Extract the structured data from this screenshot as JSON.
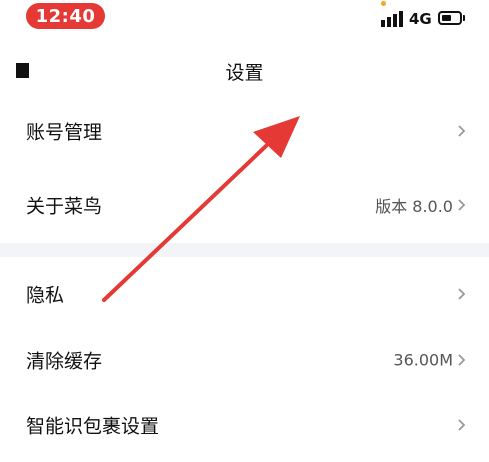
{
  "status_bar": {
    "time": "12:40",
    "network": "4G",
    "battery_level": 0.55,
    "icons": [
      "signal-icon",
      "battery-icon"
    ]
  },
  "nav": {
    "title": "设置",
    "back_icon": "back-icon"
  },
  "rows": [
    {
      "label": "账号管理",
      "value": ""
    },
    {
      "label": "关于菜鸟",
      "value": "版本 8.0.0"
    },
    {
      "label": "隐私",
      "value": ""
    },
    {
      "label": "清除缓存",
      "value": "36.00M"
    },
    {
      "label": "智能识包裹设置",
      "value": ""
    }
  ],
  "colors": {
    "time_pill": "#e53935",
    "annotation_arrow": "#e53935",
    "section_divider": "#f2f4f7"
  }
}
